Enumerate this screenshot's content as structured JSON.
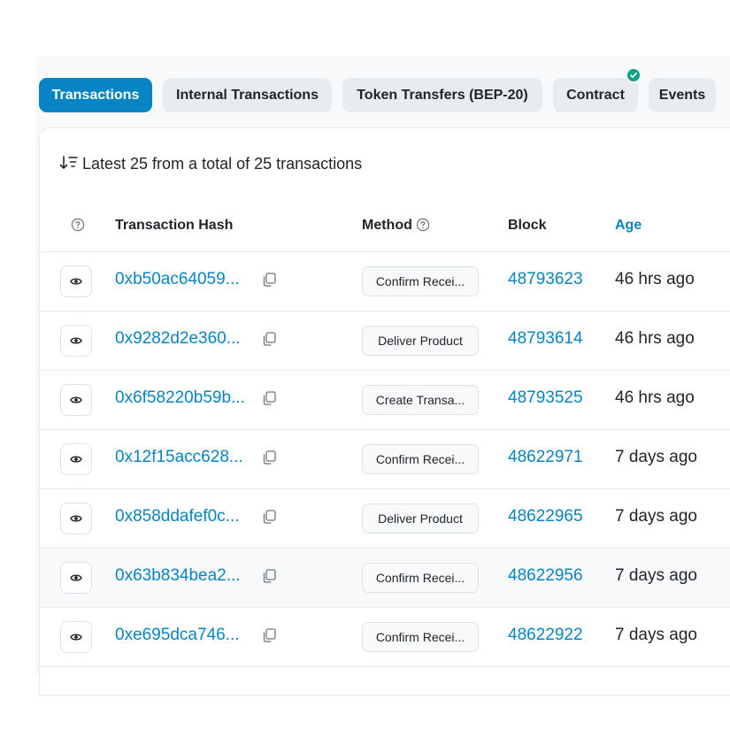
{
  "tabs": [
    {
      "label": "Transactions",
      "active": true
    },
    {
      "label": "Internal Transactions",
      "active": false
    },
    {
      "label": "Token Transfers (BEP-20)",
      "active": false
    },
    {
      "label": "Contract",
      "active": false,
      "verified": true
    },
    {
      "label": "Events",
      "active": false
    }
  ],
  "summary": "Latest 25 from a total of 25 transactions",
  "columns": {
    "hash": "Transaction Hash",
    "method": "Method",
    "block": "Block",
    "age": "Age"
  },
  "rows": [
    {
      "hash": "0xb50ac64059...",
      "method": "Confirm Recei...",
      "block": "48793623",
      "age": "46 hrs ago"
    },
    {
      "hash": "0x9282d2e360...",
      "method": "Deliver Product",
      "block": "48793614",
      "age": "46 hrs ago"
    },
    {
      "hash": "0x6f58220b59b...",
      "method": "Create Transa...",
      "block": "48793525",
      "age": "46 hrs ago"
    },
    {
      "hash": "0x12f15acc628...",
      "method": "Confirm Recei...",
      "block": "48622971",
      "age": "7 days ago"
    },
    {
      "hash": "0x858ddafef0c...",
      "method": "Deliver Product",
      "block": "48622965",
      "age": "7 days ago"
    },
    {
      "hash": "0x63b834bea2...",
      "method": "Confirm Recei...",
      "block": "48622956",
      "age": "7 days ago",
      "highlighted": true
    },
    {
      "hash": "0xe695dca746...",
      "method": "Confirm Recei...",
      "block": "48622922",
      "age": "7 days ago"
    }
  ],
  "colors": {
    "accent": "#0784c3",
    "verified": "#00a186"
  }
}
